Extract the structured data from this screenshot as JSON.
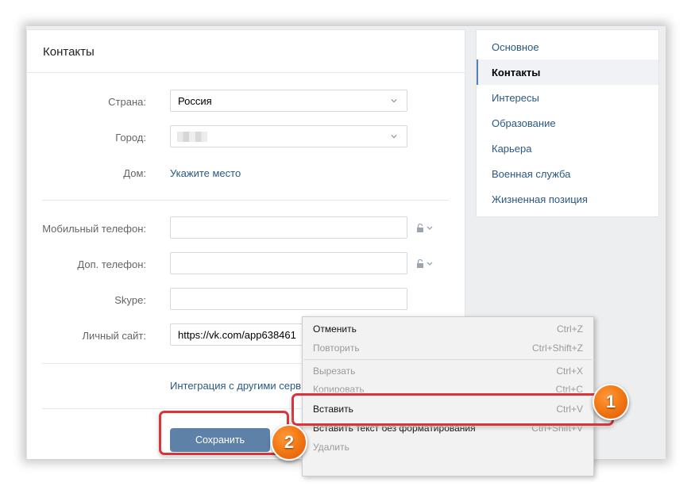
{
  "panel": {
    "title": "Контакты",
    "fields": {
      "country_label": "Страна:",
      "country_value": "Россия",
      "city_label": "Город:",
      "home_label": "Дом:",
      "home_link": "Укажите место",
      "mobile_label": "Мобильный телефон:",
      "mobile_value": "",
      "extra_phone_label": "Доп. телефон:",
      "extra_phone_value": "",
      "skype_label": "Skype:",
      "skype_value": "",
      "site_label": "Личный сайт:",
      "site_value": "https://vk.com/app638461"
    },
    "integration_link": "Интеграция с другими серв",
    "save_label": "Сохранить"
  },
  "nav": {
    "items": [
      {
        "label": "Основное",
        "active": false
      },
      {
        "label": "Контакты",
        "active": true
      },
      {
        "label": "Интересы",
        "active": false
      },
      {
        "label": "Образование",
        "active": false
      },
      {
        "label": "Карьера",
        "active": false
      },
      {
        "label": "Военная служба",
        "active": false
      },
      {
        "label": "Жизненная позиция",
        "active": false
      }
    ]
  },
  "context_menu": {
    "items": [
      {
        "label": "Отменить",
        "shortcut": "Ctrl+Z",
        "enabled": true
      },
      {
        "label": "Повторить",
        "shortcut": "Ctrl+Shift+Z",
        "enabled": false
      },
      {
        "label": "Вырезать",
        "shortcut": "Ctrl+X",
        "enabled": false
      },
      {
        "label": "Копировать",
        "shortcut": "Ctrl+C",
        "enabled": false
      },
      {
        "label": "Вставить",
        "shortcut": "Ctrl+V",
        "enabled": true
      },
      {
        "label": "Вставить текст без форматирования",
        "shortcut": "Ctrl+Shift+V",
        "enabled": true
      },
      {
        "label": "Удалить",
        "shortcut": "",
        "enabled": false
      }
    ]
  },
  "annotations": {
    "badge_1": "1",
    "badge_2": "2",
    "highlight_color": "#d9343a",
    "badge_color": "#f47a16"
  },
  "colors": {
    "link": "#2a5885",
    "button": "#5e81a8",
    "nav_active_marker": "#5181b8"
  }
}
